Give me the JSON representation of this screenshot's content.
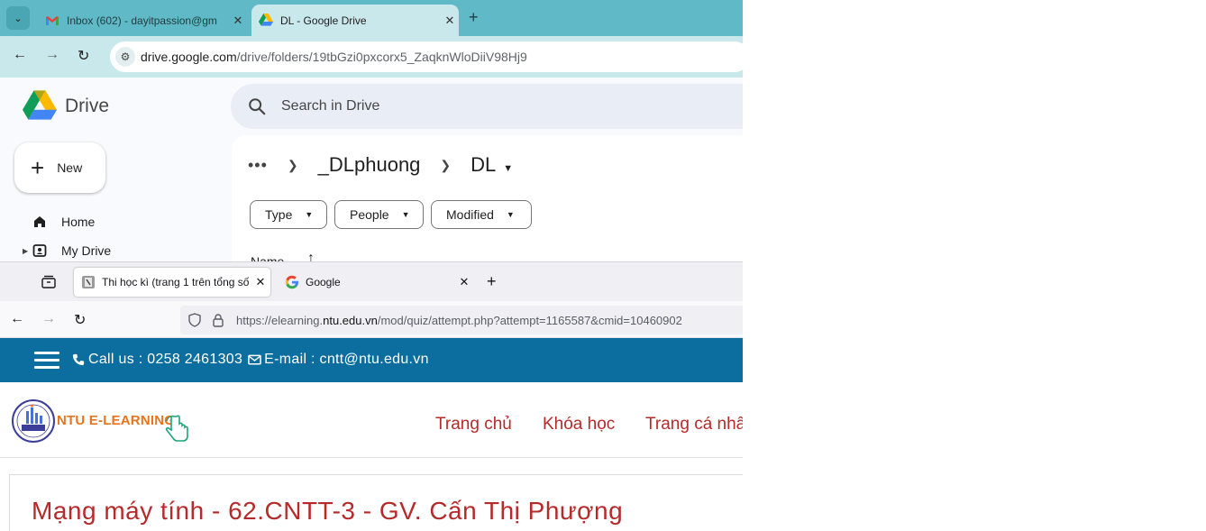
{
  "window_top": {
    "tabs": [
      {
        "title": "Inbox (602) - dayitpassion@gm",
        "icon": "gmail-icon",
        "active": false
      },
      {
        "title": "DL - Google Drive",
        "icon": "google-drive-icon",
        "active": true
      }
    ],
    "url_host": "drive.google.com",
    "url_path": "/drive/folders/19tbGzi0pxcorx5_ZaqknWloDiiV98Hj9",
    "app_name": "Drive",
    "search_placeholder": "Search in Drive",
    "new_button_label": "New",
    "sidebar": [
      {
        "label": "Home",
        "icon": "home-icon"
      },
      {
        "label": "My Drive",
        "icon": "my-drive-icon"
      }
    ],
    "breadcrumb": {
      "more": "•••",
      "parent": "_DLphuong",
      "current": "DL"
    },
    "filters": [
      "Type",
      "People",
      "Modified"
    ],
    "column_header": "Name"
  },
  "window_bottom": {
    "tabs": [
      {
        "title": "Thi học kì (trang 1 trên tổng số",
        "icon": "moodle-quiz-icon",
        "active": true
      },
      {
        "title": "Google",
        "icon": "google-g-icon",
        "active": false
      }
    ],
    "url_prefix": "https://elearning.",
    "url_domain": "ntu.edu.vn",
    "url_rest": "/mod/quiz/attempt.php?attempt=1165587&cmid=10460902",
    "contact_call": "Call us : 0258 2461303",
    "contact_email": "E-mail : cntt@ntu.edu.vn",
    "brand_text": "NTU E-LEARNING",
    "menu": [
      "Trang chủ",
      "Khóa học",
      "Trang cá nhân"
    ],
    "course_title": "Mạng máy tính - 62.CNTT-3 - GV. Cấn Thị Phượng"
  },
  "colors": {
    "chrome_tabstrip": "#5fb9c6",
    "chrome_toolbar": "#c9e8ec",
    "ntu_topbar": "#0b6e9e",
    "ntu_red": "#b52a2a",
    "ntu_orange": "#e8741e"
  }
}
